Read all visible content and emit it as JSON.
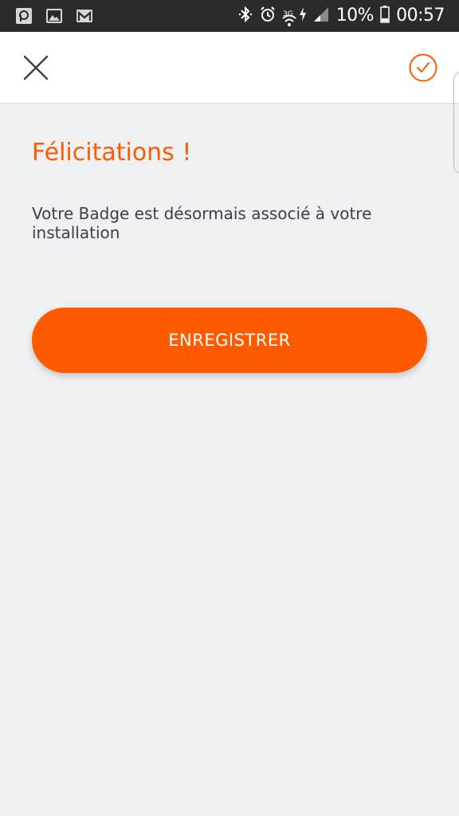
{
  "status_bar": {
    "left_icons": [
      "p-app-icon",
      "gallery-icon",
      "gmail-icon"
    ],
    "network_type": "3G",
    "battery_percent": "10%",
    "time": "00:57"
  },
  "app_bar": {
    "close_icon": "close-icon",
    "confirm_icon": "check-circle-icon",
    "accent_color": "#ff5a00"
  },
  "content": {
    "title": "Félicitations !",
    "message": "Votre Badge est désormais associé à votre installation",
    "save_button_label": "ENREGISTRER"
  },
  "colors": {
    "accent": "#ff5a00",
    "background": "#eff0f2",
    "text": "#3a3f4b",
    "status_bar": "#2b2b2b"
  }
}
